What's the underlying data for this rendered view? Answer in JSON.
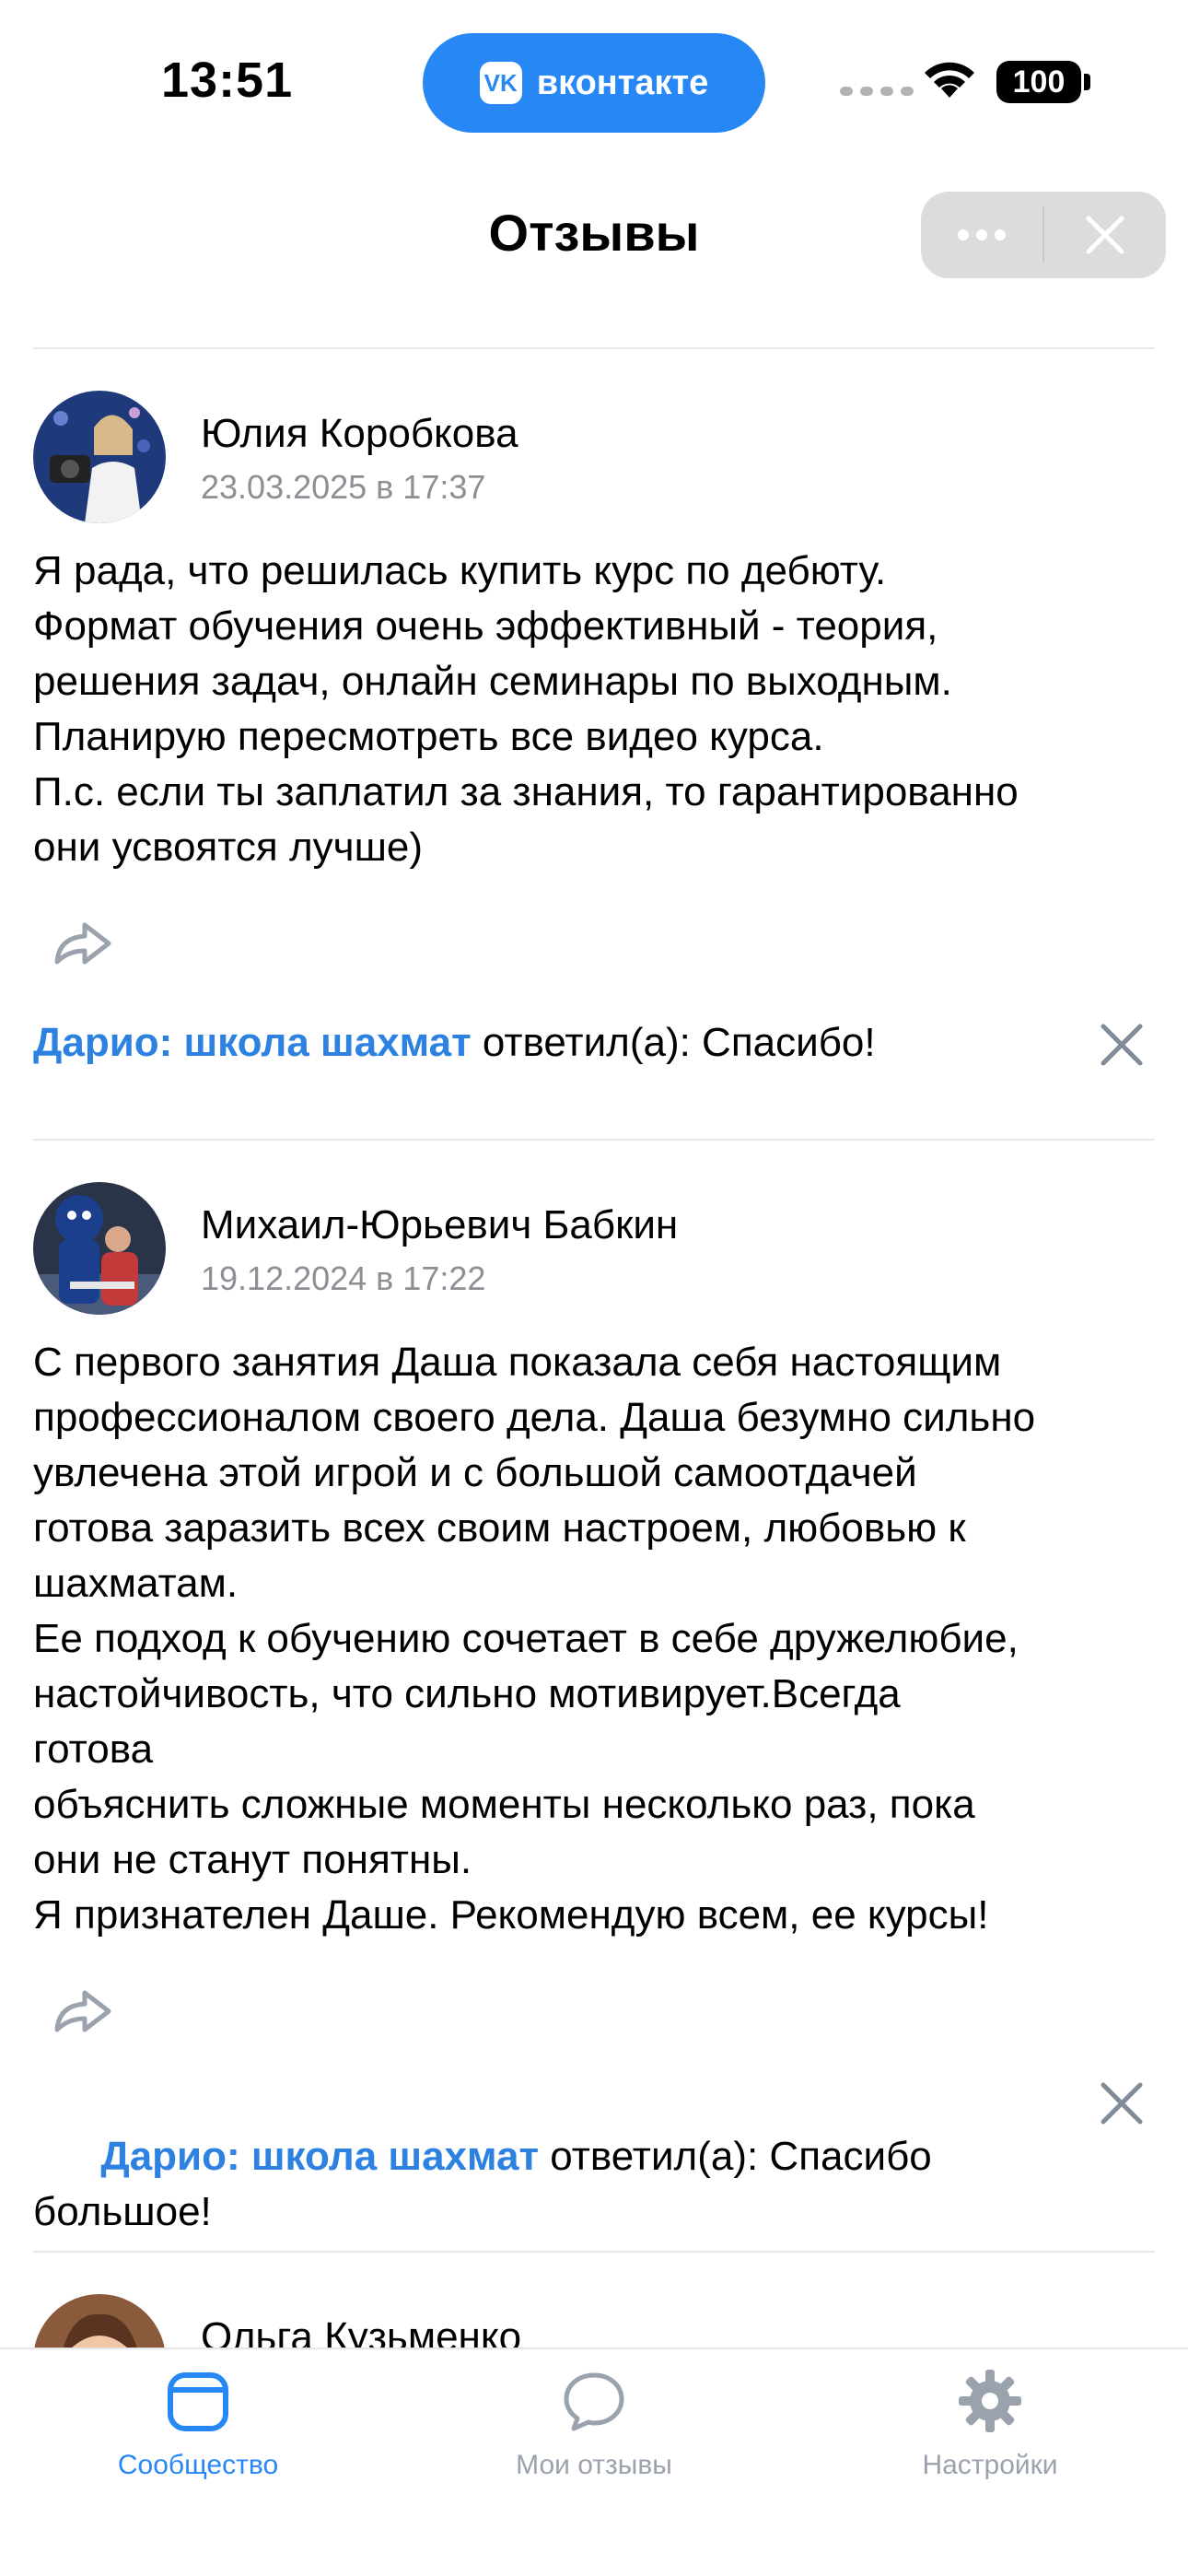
{
  "status_bar": {
    "time": "13:51",
    "app_pill_label": "вконтакте",
    "app_logo": "VK",
    "battery": "100"
  },
  "header": {
    "title": "Отзывы"
  },
  "reviews": [
    {
      "author": "Юлия Коробкова",
      "date": "23.03.2025 в 17:37",
      "text": "Я рада, что решилась купить курс по дебюту.\nФормат обучения очень эффективный - теория,\nрешения задач, онлайн семинары по выходным.\nПланирую пересмотреть все видео курса.\nП.с. если ты заплатил за знания, то гарантированно\nони усвоятся лучше)",
      "reply_name": "Дарио: школа шахмат",
      "reply_text": " ответил(а): Спасибо!"
    },
    {
      "author": "Михаил-Юрьевич Бабкин",
      "date": "19.12.2024 в 17:22",
      "text": "С первого занятия Даша показала себя настоящим\nпрофессионалом своего дела. Даша безумно сильно\nувлечена этой игрой и с большой самоотдачей\nготова заразить всех своим настроем, любовью к\nшахматам.\nЕе подход к обучению сочетает в себе дружелюбие,\nнастойчивость, что сильно мотивирует.Всегда\nготова\nобъяснить сложные моменты несколько раз, пока\nони не станут понятны.\nЯ признателен Даше. Рекомендую всем, ее курсы!",
      "reply_name": "Дарио: школа шахмат",
      "reply_text": " ответил(а): Спасибо\nбольшое!"
    },
    {
      "author": "Ольга Кузьменко"
    }
  ],
  "tabbar": {
    "tabs": [
      {
        "label": "Сообщество",
        "icon": "community-icon",
        "active": true
      },
      {
        "label": "Мои отзывы",
        "icon": "chat-bubble-icon",
        "active": false
      },
      {
        "label": "Настройки",
        "icon": "gear-icon",
        "active": false
      }
    ]
  },
  "colors": {
    "accent": "#2787f5",
    "reply_name": "#2d81e0",
    "secondary_text": "#8c8f94",
    "inactive_tab": "#99a2ad"
  }
}
